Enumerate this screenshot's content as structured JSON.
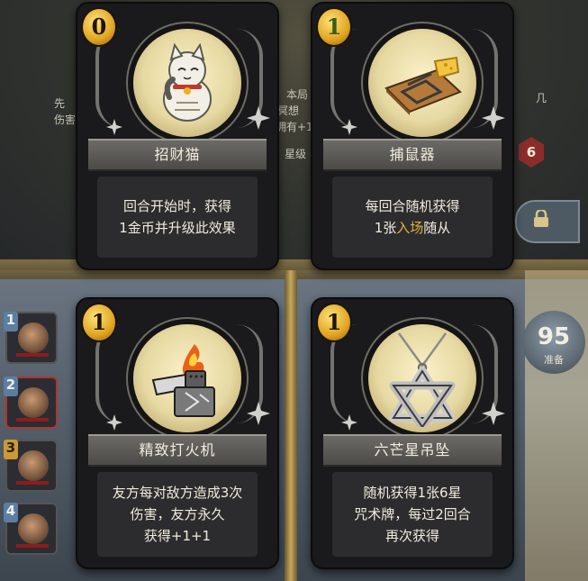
{
  "background": {
    "left_text_1": "先",
    "left_text_2": "伤害",
    "mid_text_1": "本局",
    "mid_text_2": "冥想",
    "mid_text_3": "拥有+1",
    "mid_text_4": "星级",
    "right_text": "几",
    "badge_value": "6"
  },
  "right_panel": {
    "count": "95",
    "count_label": "准备"
  },
  "left_slots": [
    {
      "num": "1"
    },
    {
      "num": "2"
    },
    {
      "num": "3"
    },
    {
      "num": "4"
    }
  ],
  "cards": [
    {
      "cost": "0",
      "name": "招财猫",
      "icon": "lucky-cat-icon",
      "desc_line1": "回合开始时，获得",
      "desc_line2": "1金币并升级此效果"
    },
    {
      "cost": "1",
      "name": "捕鼠器",
      "icon": "mousetrap-icon",
      "desc_line1": "每回合随机获得",
      "desc_pre": "1张",
      "desc_highlight": "入场",
      "desc_post": "随从"
    },
    {
      "cost": "1",
      "name": "精致打火机",
      "icon": "lighter-icon",
      "desc_line1": "友方每对敌方造成3次",
      "desc_line2": "伤害，友方永久",
      "desc_line3": "获得+1+1"
    },
    {
      "cost": "1",
      "name": "六芒星吊坠",
      "icon": "hexagram-pendant-icon",
      "desc_line1": "随机获得1张6星",
      "desc_line2": "咒术牌，每过2回合",
      "desc_line3": "再次获得"
    }
  ],
  "colors": {
    "highlight": "#e0b23c",
    "coin": "#e0a421",
    "card_bg": "#1a1a1c"
  }
}
